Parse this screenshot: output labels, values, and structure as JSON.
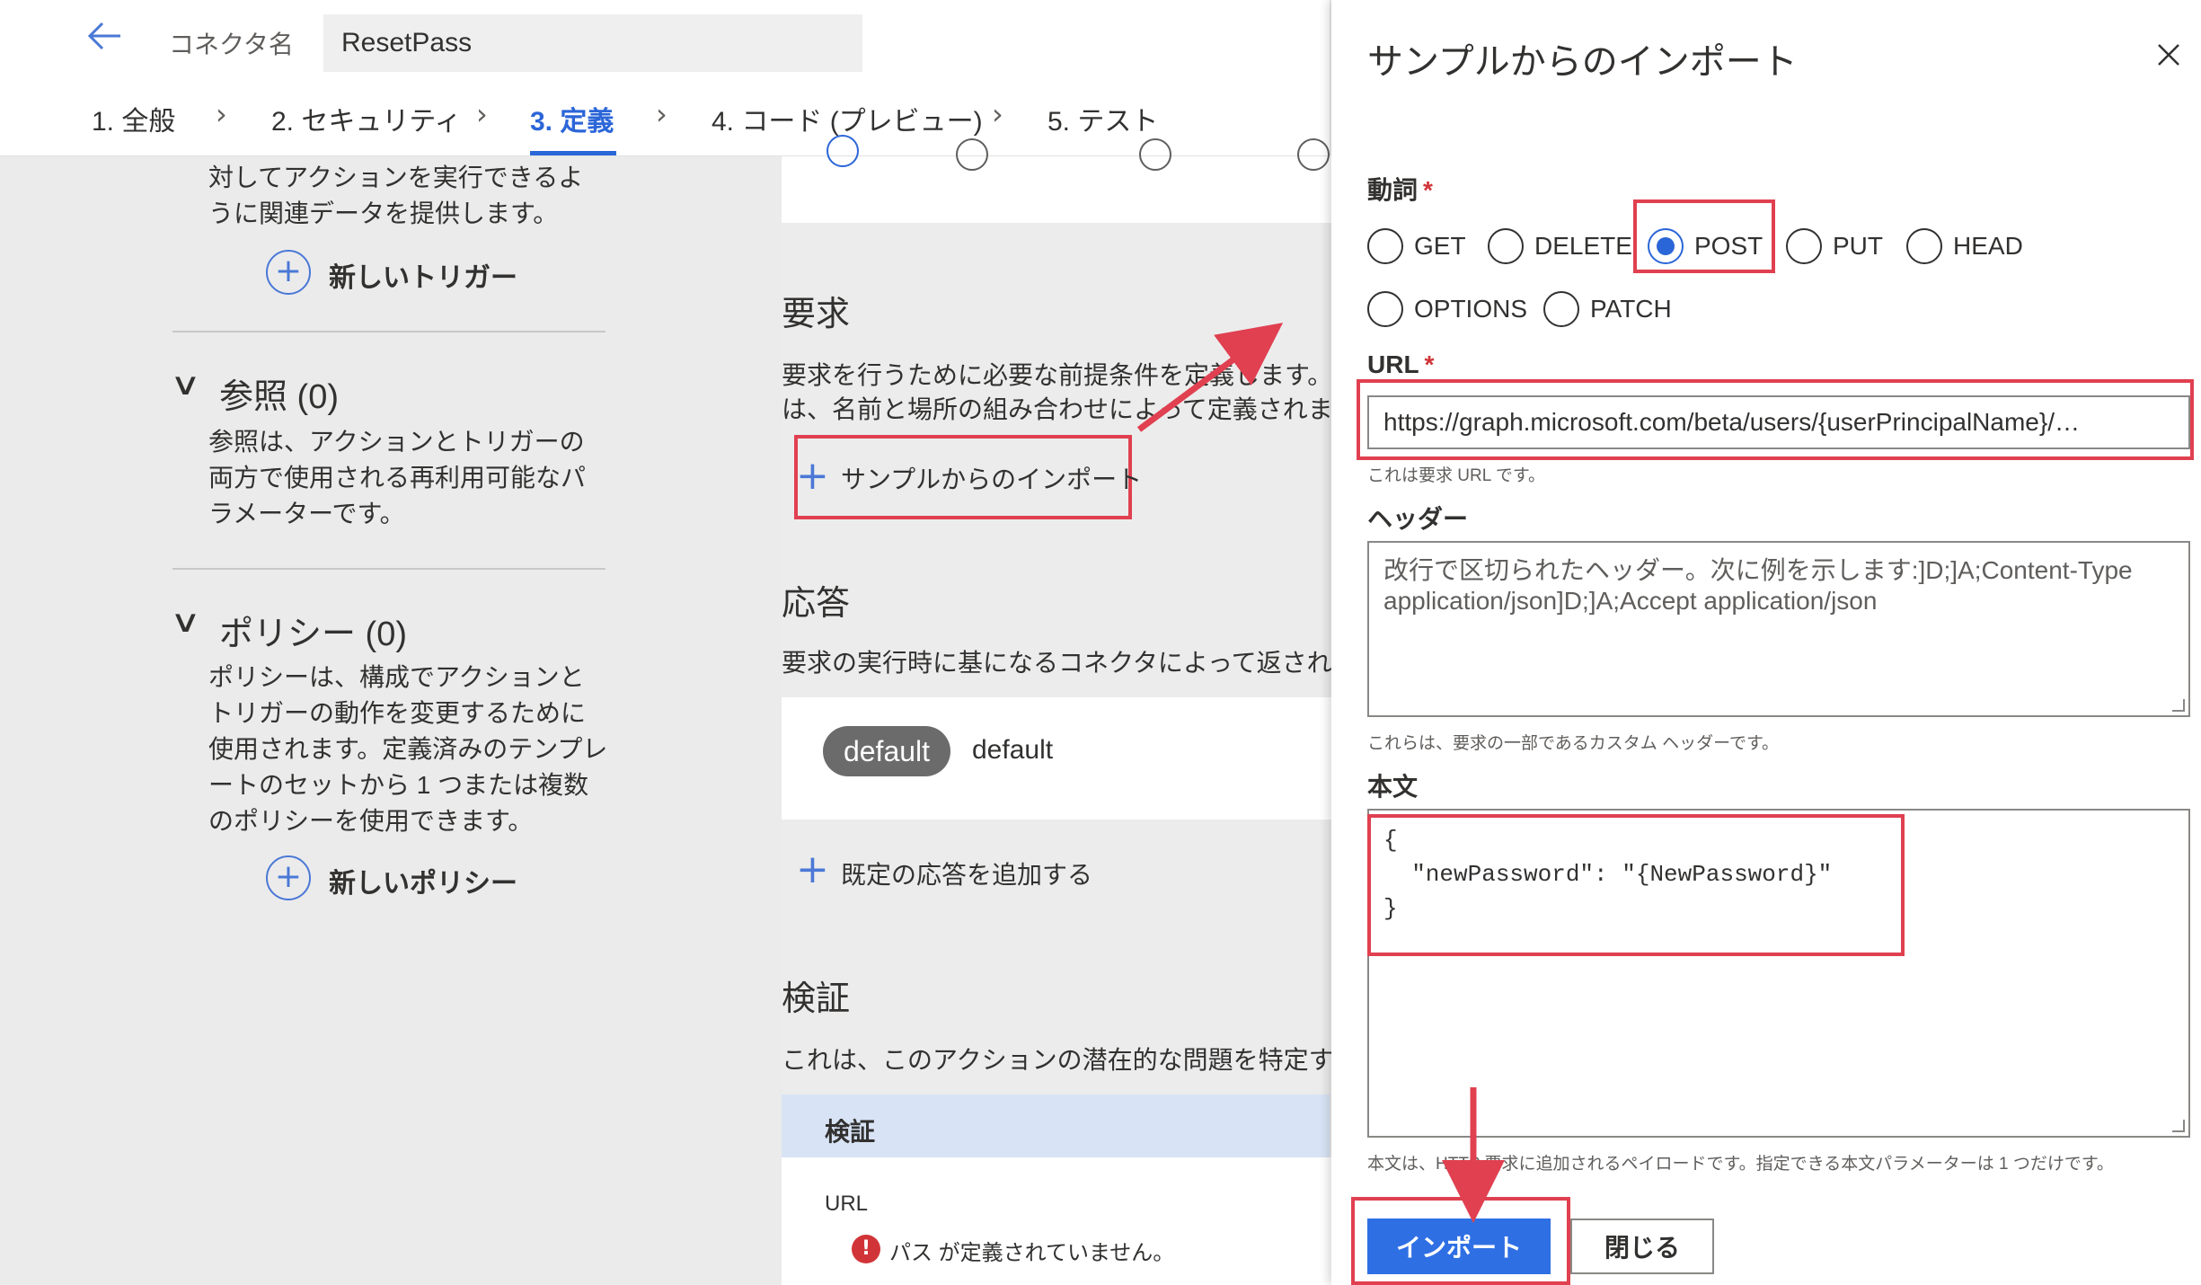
{
  "header": {
    "connector_label": "コネクタ名",
    "connector_value": "ResetPass"
  },
  "steps": [
    {
      "label": "1. 全般"
    },
    {
      "label": "2. セキュリティ"
    },
    {
      "label": "3. 定義"
    },
    {
      "label": "4. コード (プレビュー)"
    },
    {
      "label": "5. テスト"
    }
  ],
  "left": {
    "trigger_desc": "対してアクションを実行できるように関連データを提供します。",
    "new_trigger": "新しいトリガー",
    "references_title": "参照 (0)",
    "references_desc": "参照は、アクションとトリガーの両方で使用される再利用可能なパラメーターです。",
    "policies_title": "ポリシー (0)",
    "policies_desc": "ポリシーは、構成でアクションとトリガーの動作を変更するために使用されます。定義済みのテンプレートのセットから 1 つまたは複数のポリシーを使用できます。",
    "new_policy": "新しいポリシー"
  },
  "middle": {
    "request_title": "要求",
    "request_desc_1": "要求を行うために必要な前提条件を定義します。",
    "request_desc_2": "は、名前と場所の組み合わせによって定義されま",
    "import_sample": "サンプルからのインポート",
    "response_title": "応答",
    "response_desc": "要求の実行時に基になるコネクタによって返され",
    "default_pill": "default",
    "default_text": "default",
    "add_default_response": "既定の応答を追加する",
    "validation_title": "検証",
    "validation_desc": "これは、このアクションの潜在的な問題を特定する",
    "validation_bar": "検証",
    "url_label": "URL",
    "path_error": "パス が定義されていません。"
  },
  "panel": {
    "title": "サンプルからのインポート",
    "verb_label": "動詞",
    "verbs": [
      "GET",
      "DELETE",
      "POST",
      "PUT",
      "HEAD",
      "OPTIONS",
      "PATCH"
    ],
    "selected_verb": "POST",
    "url_label": "URL",
    "url_value": "https://graph.microsoft.com/beta/users/{userPrincipalName}/…",
    "url_help": "これは要求 URL です。",
    "headers_label": "ヘッダー",
    "headers_placeholder": "改行で区切られたヘッダー。次に例を示します:]D;]A;Content-Type application/json]D;]A;Accept application/json",
    "headers_help": "これらは、要求の一部であるカスタム ヘッダーです。",
    "body_label": "本文",
    "body_value": "{\n  \"newPassword\": \"{NewPassword}\"\n}",
    "body_help": "本文は、HTTP 要求に追加されるペイロードです。指定できる本文パラメーターは 1 つだけです。",
    "import_button": "インポート",
    "close_button": "閉じる",
    "required_mark": "*"
  },
  "icons": {
    "back": "back-arrow-icon",
    "close": "close-icon",
    "plus": "plus-icon",
    "error": "error-icon"
  },
  "colors": {
    "accent": "#2b66d8",
    "primary_button": "#2f6fe4",
    "highlight": "#e04050",
    "error": "#d13438"
  }
}
